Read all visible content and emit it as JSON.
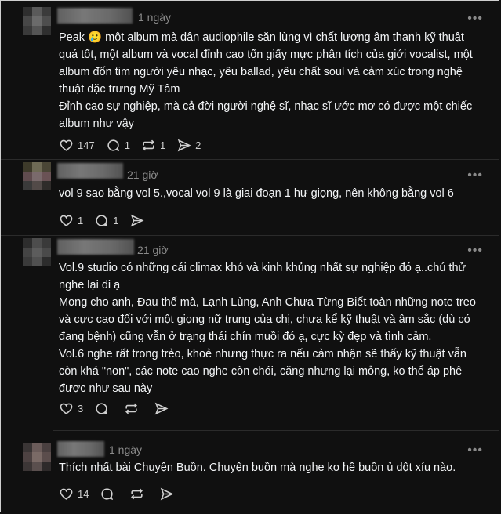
{
  "posts": [
    {
      "time": "1 ngày",
      "more_label": "•••",
      "lines": [
        "Peak 🥲 một album mà dân audiophile săn lùng vì chất lượng âm thanh kỹ thuật quá tốt, một album và vocal đỉnh cao tốn giấy mực phân tích của giới vocalist, một album đốn tim người yêu nhạc, yêu ballad, yêu chất soul và cảm xúc trong nghệ thuật đặc trưng Mỹ Tâm",
        "Đỉnh cao sự nghiệp, mà cả đời người nghệ sĩ, nhạc sĩ ước mơ có được một chiếc album như vậy"
      ],
      "counts": {
        "likes": "147",
        "replies": "1",
        "reposts": "1",
        "shares": "2"
      }
    },
    {
      "time": "21 giờ",
      "more_label": "•••",
      "lines": [
        "vol 9 sao bằng vol 5.,vocal vol 9 là giai đoạn 1 hư giọng, nên không bằng vol 6"
      ],
      "counts": {
        "likes": "1",
        "replies": "1",
        "reposts": "",
        "shares": ""
      }
    },
    {
      "time": "21 giờ",
      "more_label": "•••",
      "lines": [
        "Vol.9 studio có những cái climax khó và kinh khủng nhất sự nghiệp đó ạ..chú thử nghe lại đi ạ",
        "Mong cho anh, Đau thế mà, Lạnh Lùng, Anh Chưa Từng Biết toàn những note treo và cực cao đối với một giọng nữ trung của chị, chưa kể kỹ thuật và âm sắc (dù có đang bệnh) cũng vẫn ở trạng thái chín muồi đó ạ, cực kỳ đẹp và tình cảm.",
        "Vol.6 nghe rất trong trẻo, khoẻ nhưng thực ra nếu cảm nhận sẽ thấy kỹ thuật vẫn còn khá \"non\", các note cao nghe còn chói, căng nhưng lại mỏng, ko thể áp phê được như sau này"
      ],
      "counts": {
        "likes": "3",
        "replies": "",
        "reposts": "",
        "shares": ""
      }
    },
    {
      "time": "1 ngày",
      "more_label": "•••",
      "lines": [
        "Thích nhất bài Chuyện Buồn. Chuyện buồn mà nghe ko hề buồn ủ dột xíu nào."
      ],
      "counts": {
        "likes": "14",
        "replies": "",
        "reposts": "",
        "shares": ""
      }
    }
  ],
  "colors": {
    "background": "#101010",
    "text": "#f3f5f7",
    "muted": "#8a8a8a",
    "border": "#cfcfcf"
  },
  "icons": [
    "heart-icon",
    "comment-icon",
    "repost-icon",
    "share-icon",
    "more-icon"
  ]
}
